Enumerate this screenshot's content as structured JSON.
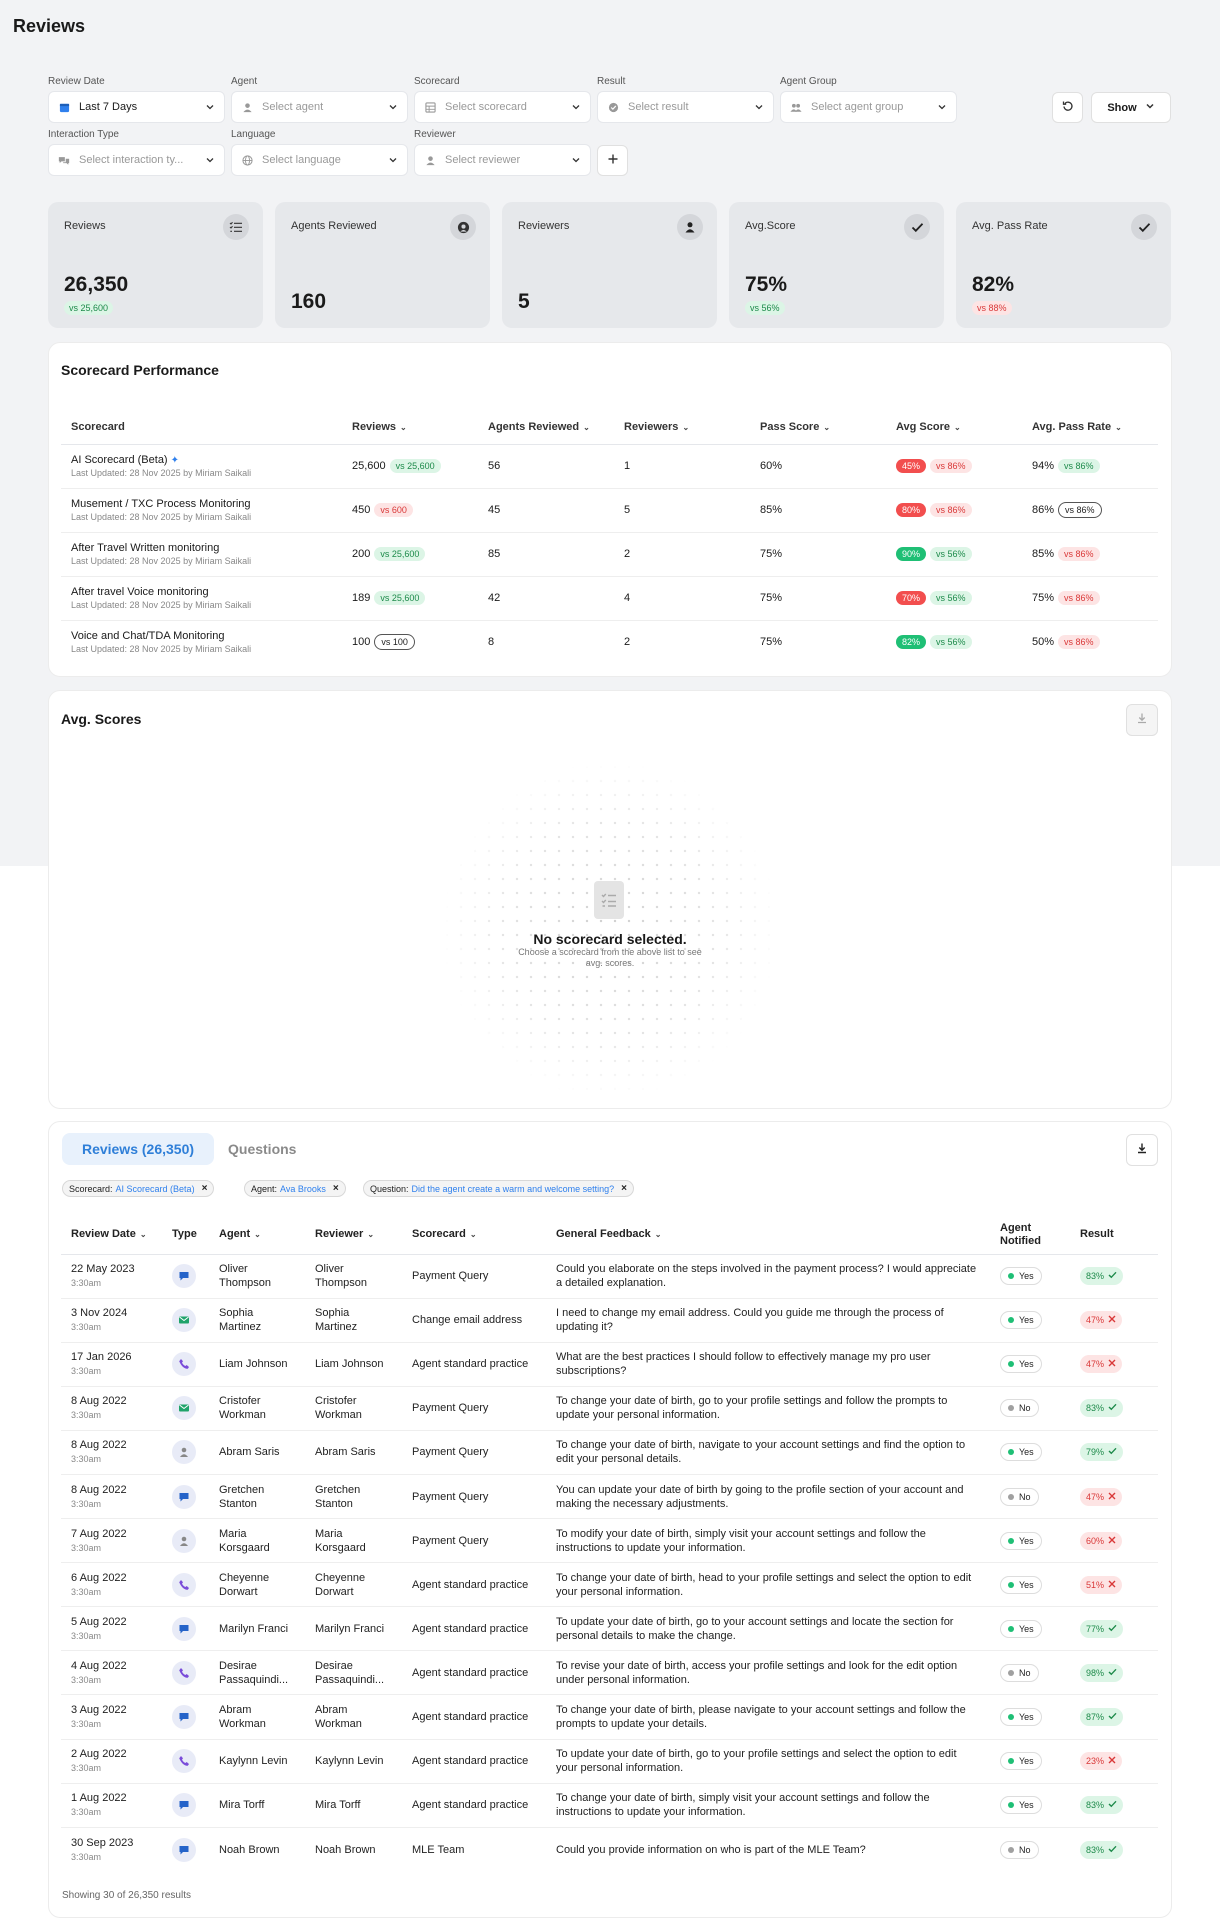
{
  "page": {
    "title": "Reviews"
  },
  "filters": {
    "review_date": {
      "label": "Review Date",
      "value": "Last 7 Days"
    },
    "agent": {
      "label": "Agent",
      "placeholder": "Select agent"
    },
    "scorecard": {
      "label": "Scorecard",
      "placeholder": "Select scorecard"
    },
    "result": {
      "label": "Result",
      "placeholder": "Select result"
    },
    "agent_group": {
      "label": "Agent Group",
      "placeholder": "Select agent group"
    },
    "interaction_type": {
      "label": "Interaction Type",
      "placeholder": "Select interaction ty..."
    },
    "language": {
      "label": "Language",
      "placeholder": "Select language"
    },
    "reviewer": {
      "label": "Reviewer",
      "placeholder": "Select reviewer"
    },
    "show_label": "Show"
  },
  "kpis": [
    {
      "label": "Reviews",
      "value": "26,350",
      "compare": "vs 25,600",
      "trend": "up",
      "icon": "checklist-icon"
    },
    {
      "label": "Agents Reviewed",
      "value": "160",
      "icon": "agent-headset-icon"
    },
    {
      "label": "Reviewers",
      "value": "5",
      "icon": "user-icon"
    },
    {
      "label": "Avg.Score",
      "value": "75%",
      "compare": "vs 56%",
      "trend": "up",
      "icon": "check-icon"
    },
    {
      "label": "Avg. Pass Rate",
      "value": "82%",
      "compare": "vs 88%",
      "trend": "down",
      "icon": "check-icon"
    }
  ],
  "scorecard_performance": {
    "title": "Scorecard Performance",
    "columns": [
      "Scorecard",
      "Reviews",
      "Agents Reviewed",
      "Reviewers",
      "Pass Score",
      "Avg Score",
      "Avg. Pass Rate"
    ],
    "rows": [
      {
        "name": "AI Scorecard (Beta)",
        "updated": "Last Updated: 28 Nov 2025 by Miriam Saikali",
        "reviews": "25,600",
        "reviews_vs": "vs 25,600",
        "agents": "56",
        "reviewers": "1",
        "pass_score": "60%",
        "avg_score": "45%",
        "avg_vs": "vs 86%",
        "pass_rate": "94%",
        "pass_rate_vs": "vs 86%"
      },
      {
        "name": "Musement / TXC Process Monitoring",
        "updated": "Last Updated: 28 Nov 2025 by Miriam Saikali",
        "reviews": "450",
        "reviews_vs": "vs 600",
        "agents": "45",
        "reviewers": "5",
        "pass_score": "85%",
        "avg_score": "80%",
        "avg_vs": "vs 86%",
        "pass_rate": "86%",
        "pass_rate_vs": "vs 86%"
      },
      {
        "name": "After Travel Written monitoring",
        "updated": "Last Updated: 28 Nov 2025 by Miriam Saikali",
        "reviews": "200",
        "reviews_vs": "vs 25,600",
        "agents": "85",
        "reviewers": "2",
        "pass_score": "75%",
        "avg_score": "90%",
        "avg_vs": "vs 56%",
        "pass_rate": "85%",
        "pass_rate_vs": "vs 86%"
      },
      {
        "name": "After travel Voice monitoring",
        "updated": "Last Updated: 28 Nov 2025 by Miriam Saikali",
        "reviews": "189",
        "reviews_vs": "vs 25,600",
        "agents": "42",
        "reviewers": "4",
        "pass_score": "75%",
        "avg_score": "70%",
        "avg_vs": "vs 56%",
        "pass_rate": "75%",
        "pass_rate_vs": "vs 86%"
      },
      {
        "name": "Voice and Chat/TDA Monitoring",
        "updated": "Last Updated: 28 Nov 2025 by Miriam Saikali",
        "reviews": "100",
        "reviews_vs": "vs 100",
        "agents": "8",
        "reviewers": "2",
        "pass_score": "75%",
        "avg_score": "82%",
        "avg_vs": "vs 56%",
        "pass_rate": "50%",
        "pass_rate_vs": "vs 86%"
      }
    ]
  },
  "avg_scores": {
    "title": "Avg. Scores",
    "empty_title": "No scorecard selected.",
    "empty_sub": "Choose a scorecard from the above list to see avg. scores."
  },
  "reviews": {
    "tab_reviews": "Reviews (26,350)",
    "tab_questions": "Questions",
    "chips": [
      {
        "key": "Scorecard:",
        "value": "AI Scorecard (Beta)"
      },
      {
        "key": "Agent:",
        "value": "Ava Brooks"
      },
      {
        "key": "Question:",
        "value": "Did the agent create a warm and welcome setting?"
      }
    ],
    "columns": {
      "date": "Review Date",
      "type": "Type",
      "agent": "Agent",
      "reviewer": "Reviewer",
      "scorecard": "Scorecard",
      "feedback": "General Feedback",
      "notified": "Agent Notified",
      "result": "Result"
    },
    "rows": [
      {
        "date": "22 May 2023",
        "time": "3:30am",
        "type": "chat-icon",
        "agent": "Oliver Thompson",
        "reviewer": "Oliver Thompson",
        "scorecard": "Payment Query",
        "feedback": "Could you elaborate on the steps involved in the payment process? I would appreciate a detailed explanation.",
        "notified": "Yes",
        "result": "83%",
        "pass": true
      },
      {
        "date": "3 Nov 2024",
        "time": "3:30am",
        "type": "email-icon",
        "agent": "Sophia Martinez",
        "reviewer": "Sophia Martinez",
        "scorecard": "Change email address",
        "feedback": "I need to change my email address. Could you guide me through the process of updating it?",
        "notified": "Yes",
        "result": "47%",
        "pass": false
      },
      {
        "date": "17 Jan 2026",
        "time": "3:30am",
        "type": "phone-icon",
        "agent": "Liam Johnson",
        "reviewer": "Liam Johnson",
        "scorecard": "Agent standard practice",
        "feedback": "What are the best practices I should follow to effectively manage my pro user subscriptions?",
        "notified": "Yes",
        "result": "47%",
        "pass": false
      },
      {
        "date": "8 Aug 2022",
        "time": "3:30am",
        "type": "email-icon",
        "agent": "Cristofer Workman",
        "reviewer": "Cristofer Workman",
        "scorecard": "Payment Query",
        "feedback": "To change your date of birth, go to your profile settings and follow the prompts to update your personal information.",
        "notified": "No",
        "result": "83%",
        "pass": true
      },
      {
        "date": "8 Aug 2022",
        "time": "3:30am",
        "type": "person-icon",
        "agent": "Abram Saris",
        "reviewer": "Abram Saris",
        "scorecard": "Payment Query",
        "feedback": "To change your date of birth, navigate to your account settings and find the option to edit your personal details.",
        "notified": "Yes",
        "result": "79%",
        "pass": true
      },
      {
        "date": "8 Aug 2022",
        "time": "3:30am",
        "type": "chat-icon",
        "agent": "Gretchen Stanton",
        "reviewer": "Gretchen Stanton",
        "scorecard": "Payment Query",
        "feedback": "You can update your date of birth by going to the profile section of your account and making the necessary adjustments.",
        "notified": "No",
        "result": "47%",
        "pass": false
      },
      {
        "date": "7 Aug 2022",
        "time": "3:30am",
        "type": "person-icon",
        "agent": "Maria Korsgaard",
        "reviewer": "Maria Korsgaard",
        "scorecard": "Payment Query",
        "feedback": "To modify your date of birth, simply visit your account settings and follow the instructions to update your information.",
        "notified": "Yes",
        "result": "60%",
        "pass": false
      },
      {
        "date": "6 Aug 2022",
        "time": "3:30am",
        "type": "phone-icon",
        "agent": "Cheyenne Dorwart",
        "reviewer": "Cheyenne Dorwart",
        "scorecard": "Agent standard practice",
        "feedback": "To change your date of birth, head to your profile settings and select the option to edit your personal information.",
        "notified": "Yes",
        "result": "51%",
        "pass": false
      },
      {
        "date": "5 Aug 2022",
        "time": "3:30am",
        "type": "chat-icon",
        "agent": "Marilyn Franci",
        "reviewer": "Marilyn Franci",
        "scorecard": "Agent standard practice",
        "feedback": "To update your date of birth, go to your account settings and locate the section for personal details to make the change.",
        "notified": "Yes",
        "result": "77%",
        "pass": true
      },
      {
        "date": "4 Aug 2022",
        "time": "3:30am",
        "type": "phone-icon",
        "agent": "Desirae Passaquindi...",
        "reviewer": "Desirae Passaquindi...",
        "scorecard": "Agent standard practice",
        "feedback": "To revise your date of birth, access your profile settings and look for the edit option under personal information.",
        "notified": "No",
        "result": "98%",
        "pass": true
      },
      {
        "date": "3 Aug 2022",
        "time": "3:30am",
        "type": "chat-icon",
        "agent": "Abram Workman",
        "reviewer": "Abram Workman",
        "scorecard": "Agent standard practice",
        "feedback": "To change your date of birth, please navigate to your account settings and follow the prompts to update your details.",
        "notified": "Yes",
        "result": "87%",
        "pass": true
      },
      {
        "date": "2 Aug 2022",
        "time": "3:30am",
        "type": "phone-icon",
        "agent": "Kaylynn Levin",
        "reviewer": "Kaylynn Levin",
        "scorecard": "Agent standard practice",
        "feedback": "To update your date of birth, go to your profile settings and select the option to edit your personal information.",
        "notified": "Yes",
        "result": "23%",
        "pass": false
      },
      {
        "date": "1 Aug 2022",
        "time": "3:30am",
        "type": "chat-icon",
        "agent": "Mira Torff",
        "reviewer": "Mira Torff",
        "scorecard": "Agent standard practice",
        "feedback": "To change your date of birth, simply visit your account settings and follow the instructions to update your information.",
        "notified": "Yes",
        "result": "83%",
        "pass": true
      },
      {
        "date": "30 Sep 2023",
        "time": "3:30am",
        "type": "chat-icon",
        "agent": "Noah Brown",
        "reviewer": "Noah Brown",
        "scorecard": "MLE Team",
        "feedback": "Could you provide information on who is part of the MLE Team?",
        "notified": "No",
        "result": "83%",
        "pass": true
      }
    ],
    "footer": "Showing 30 of 26,350 results"
  },
  "colors": {
    "accent": "#2f80ed",
    "pass": "#1d8a4a",
    "fail": "#d93838",
    "notified_yes": "#1fbf75",
    "notified_no": "#a0a0a0"
  }
}
